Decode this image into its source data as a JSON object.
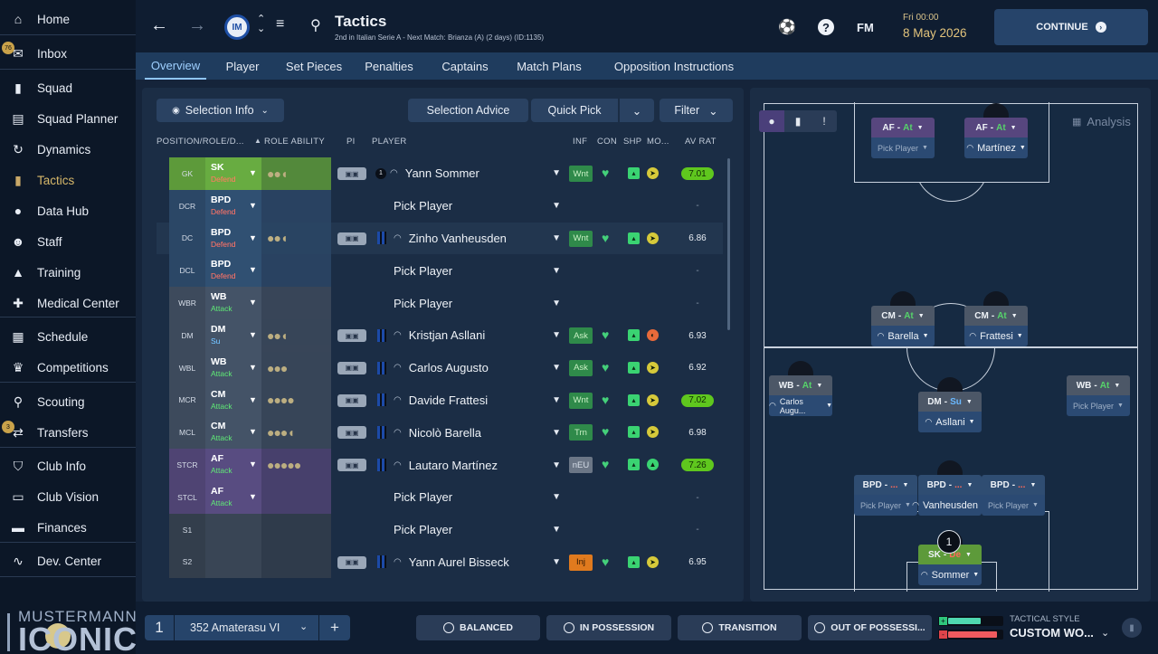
{
  "sidebar": {
    "items": [
      {
        "label": "Home",
        "icon": "home-icon"
      },
      {
        "label": "Inbox",
        "icon": "inbox-icon",
        "badge": "76"
      },
      {
        "label": "Squad",
        "icon": "shirt-icon"
      },
      {
        "label": "Squad Planner",
        "icon": "clipboard-icon"
      },
      {
        "label": "Dynamics",
        "icon": "dynamics-icon"
      },
      {
        "label": "Tactics",
        "icon": "tactics-icon",
        "active": true
      },
      {
        "label": "Data Hub",
        "icon": "data-hub-icon"
      },
      {
        "label": "Staff",
        "icon": "staff-icon"
      },
      {
        "label": "Training",
        "icon": "training-icon"
      },
      {
        "label": "Medical Center",
        "icon": "medical-icon"
      },
      {
        "label": "Schedule",
        "icon": "calendar-icon"
      },
      {
        "label": "Competitions",
        "icon": "trophy-icon"
      },
      {
        "label": "Scouting",
        "icon": "search-icon"
      },
      {
        "label": "Transfers",
        "icon": "transfer-icon",
        "badge": "3"
      },
      {
        "label": "Club Info",
        "icon": "shield-icon"
      },
      {
        "label": "Club Vision",
        "icon": "briefcase-icon"
      },
      {
        "label": "Finances",
        "icon": "finance-icon"
      },
      {
        "label": "Dev. Center",
        "icon": "dev-center-icon"
      }
    ],
    "brand_top": "MUSTERMANN",
    "brand_bottom": "ICONIC"
  },
  "header": {
    "title": "Tactics",
    "subtitle": "2nd in Italian Serie A - Next Match: Brianza (A) (2 days) (ID:1135)",
    "time": "Fri 00:00",
    "date": "8 May 2026",
    "fm_label": "FM",
    "continue_label": "CONTINUE"
  },
  "tabs": [
    "Overview",
    "Player",
    "Set Pieces",
    "Penalties",
    "Captains",
    "Match Plans",
    "Opposition Instructions"
  ],
  "toolbar": {
    "selection_info": "Selection Info",
    "selection_advice": "Selection Advice",
    "quick_pick": "Quick Pick",
    "filter": "Filter"
  },
  "columns": {
    "position": "POSITION/ROLE/D...",
    "role_ability": "ROLE ABILITY",
    "pi": "PI",
    "player": "PLAYER",
    "inf": "INF",
    "con": "CON",
    "shp": "SHP",
    "mo": "MO...",
    "av_rat": "AV RAT"
  },
  "rows": [
    {
      "pos": "GK",
      "role": "SK",
      "duty": "Defend",
      "ability": "●●◖",
      "player": "Yann Sommer",
      "inf": "Wnt",
      "rating": "7.01",
      "rat_hi": true,
      "color": "#5d9a3a",
      "dutycolor": "#ff6a5a",
      "num": "1"
    },
    {
      "pos": "DCR",
      "role": "BPD",
      "duty": "Defend",
      "ability": "",
      "player": "Pick Player",
      "inf": "",
      "rating": "-",
      "color": "#2b4766",
      "dutycolor": "#ff6a5a"
    },
    {
      "pos": "DC",
      "role": "BPD",
      "duty": "Defend",
      "ability": "●●◖",
      "player": "Zinho Vanheusden",
      "inf": "Wnt",
      "rating": "6.86",
      "color": "#2b4766",
      "dutycolor": "#ff6a5a"
    },
    {
      "pos": "DCL",
      "role": "BPD",
      "duty": "Defend",
      "ability": "",
      "player": "Pick Player",
      "inf": "",
      "rating": "-",
      "color": "#2b4766",
      "dutycolor": "#ff6a5a"
    },
    {
      "pos": "WBR",
      "role": "WB",
      "duty": "Attack",
      "ability": "",
      "player": "Pick Player",
      "inf": "",
      "rating": "-",
      "color": "#3d4a5c",
      "dutycolor": "#56d36a"
    },
    {
      "pos": "DM",
      "role": "DM",
      "duty": "Su",
      "ability": "●●◖",
      "player": "Kristjan Asllani",
      "inf": "Ask",
      "rating": "6.93",
      "color": "#3d4a5c",
      "dutycolor": "#6ab8ff"
    },
    {
      "pos": "WBL",
      "role": "WB",
      "duty": "Attack",
      "ability": "●●●",
      "player": "Carlos Augusto",
      "inf": "Ask",
      "rating": "6.92",
      "color": "#3d4a5c",
      "dutycolor": "#56d36a"
    },
    {
      "pos": "MCR",
      "role": "CM",
      "duty": "Attack",
      "ability": "●●●●",
      "player": "Davide Frattesi",
      "inf": "Wnt",
      "rating": "7.02",
      "rat_hi": true,
      "color": "#3d4a5c",
      "dutycolor": "#56d36a"
    },
    {
      "pos": "MCL",
      "role": "CM",
      "duty": "Attack",
      "ability": "●●●◖",
      "player": "Nicolò Barella",
      "inf": "Trn",
      "rating": "6.98",
      "color": "#3d4a5c",
      "dutycolor": "#56d36a"
    },
    {
      "pos": "STCR",
      "role": "AF",
      "duty": "Attack",
      "ability": "●●●●●",
      "player": "Lautaro Martínez",
      "inf": "nEU",
      "rating": "7.26",
      "rat_hi": true,
      "color": "#4f4473",
      "dutycolor": "#56d36a"
    },
    {
      "pos": "STCL",
      "role": "AF",
      "duty": "Attack",
      "ability": "",
      "player": "Pick Player",
      "inf": "",
      "rating": "-",
      "color": "#4f4473",
      "dutycolor": "#56d36a"
    },
    {
      "pos": "S1",
      "role": "",
      "duty": "",
      "ability": "",
      "player": "Pick Player",
      "inf": "",
      "rating": "-",
      "color": "#333e4c",
      "dutycolor": "#56d36a"
    },
    {
      "pos": "S2",
      "role": "",
      "duty": "",
      "ability": "",
      "player": "Yann Aurel Bisseck",
      "inf": "Inj",
      "rating": "6.95",
      "color": "#333e4c",
      "dutycolor": "#56d36a"
    }
  ],
  "pitch": {
    "analysis": "Analysis",
    "cards": [
      {
        "role": "AF",
        "duty": "At",
        "player": "Pick Player",
        "empty": true,
        "color": "#57467e",
        "dutycolor": "#56d36a"
      },
      {
        "role": "AF",
        "duty": "At",
        "player": "Martínez",
        "empty": false,
        "color": "#57467e",
        "dutycolor": "#56d36a"
      },
      {
        "role": "CM",
        "duty": "At",
        "player": "Barella",
        "empty": false,
        "color": "#4c5767",
        "dutycolor": "#56d36a"
      },
      {
        "role": "CM",
        "duty": "At",
        "player": "Frattesi",
        "empty": false,
        "color": "#4c5767",
        "dutycolor": "#56d36a"
      },
      {
        "role": "WB",
        "duty": "At",
        "player": "Carlos Augu...",
        "empty": false,
        "color": "#4c5767",
        "dutycolor": "#56d36a"
      },
      {
        "role": "DM",
        "duty": "Su",
        "player": "Asllani",
        "empty": false,
        "color": "#4c5767",
        "dutycolor": "#6ab8ff"
      },
      {
        "role": "WB",
        "duty": "At",
        "player": "Pick Player",
        "empty": true,
        "color": "#4c5767",
        "dutycolor": "#56d36a"
      },
      {
        "role": "BPD",
        "duty": "...",
        "player": "Pick Player",
        "empty": true,
        "color": "#2f4d72",
        "dutycolor": "#ff6a5a"
      },
      {
        "role": "BPD",
        "duty": "...",
        "player": "Vanheusden",
        "empty": false,
        "color": "#2f4d72",
        "dutycolor": "#ff6a5a"
      },
      {
        "role": "BPD",
        "duty": "...",
        "player": "Pick Player",
        "empty": true,
        "color": "#2f4d72",
        "dutycolor": "#ff6a5a"
      },
      {
        "role": "SK",
        "duty": "De",
        "player": "Sommer",
        "empty": false,
        "color": "#5d9a3a",
        "dutycolor": "#ff6a5a"
      }
    ]
  },
  "bottom": {
    "slot": "1",
    "tactic_name": "352 Amaterasu VI",
    "add": "+",
    "balanced": "BALANCED",
    "in_possession": "IN POSSESSION",
    "transition": "TRANSITION",
    "out_of_possession": "OUT OF POSSESSI...",
    "tactical_style_label": "TACTICAL STYLE",
    "tactical_style_value": "CUSTOM WO...",
    "style_plus": 0.6,
    "style_minus": 0.9
  }
}
